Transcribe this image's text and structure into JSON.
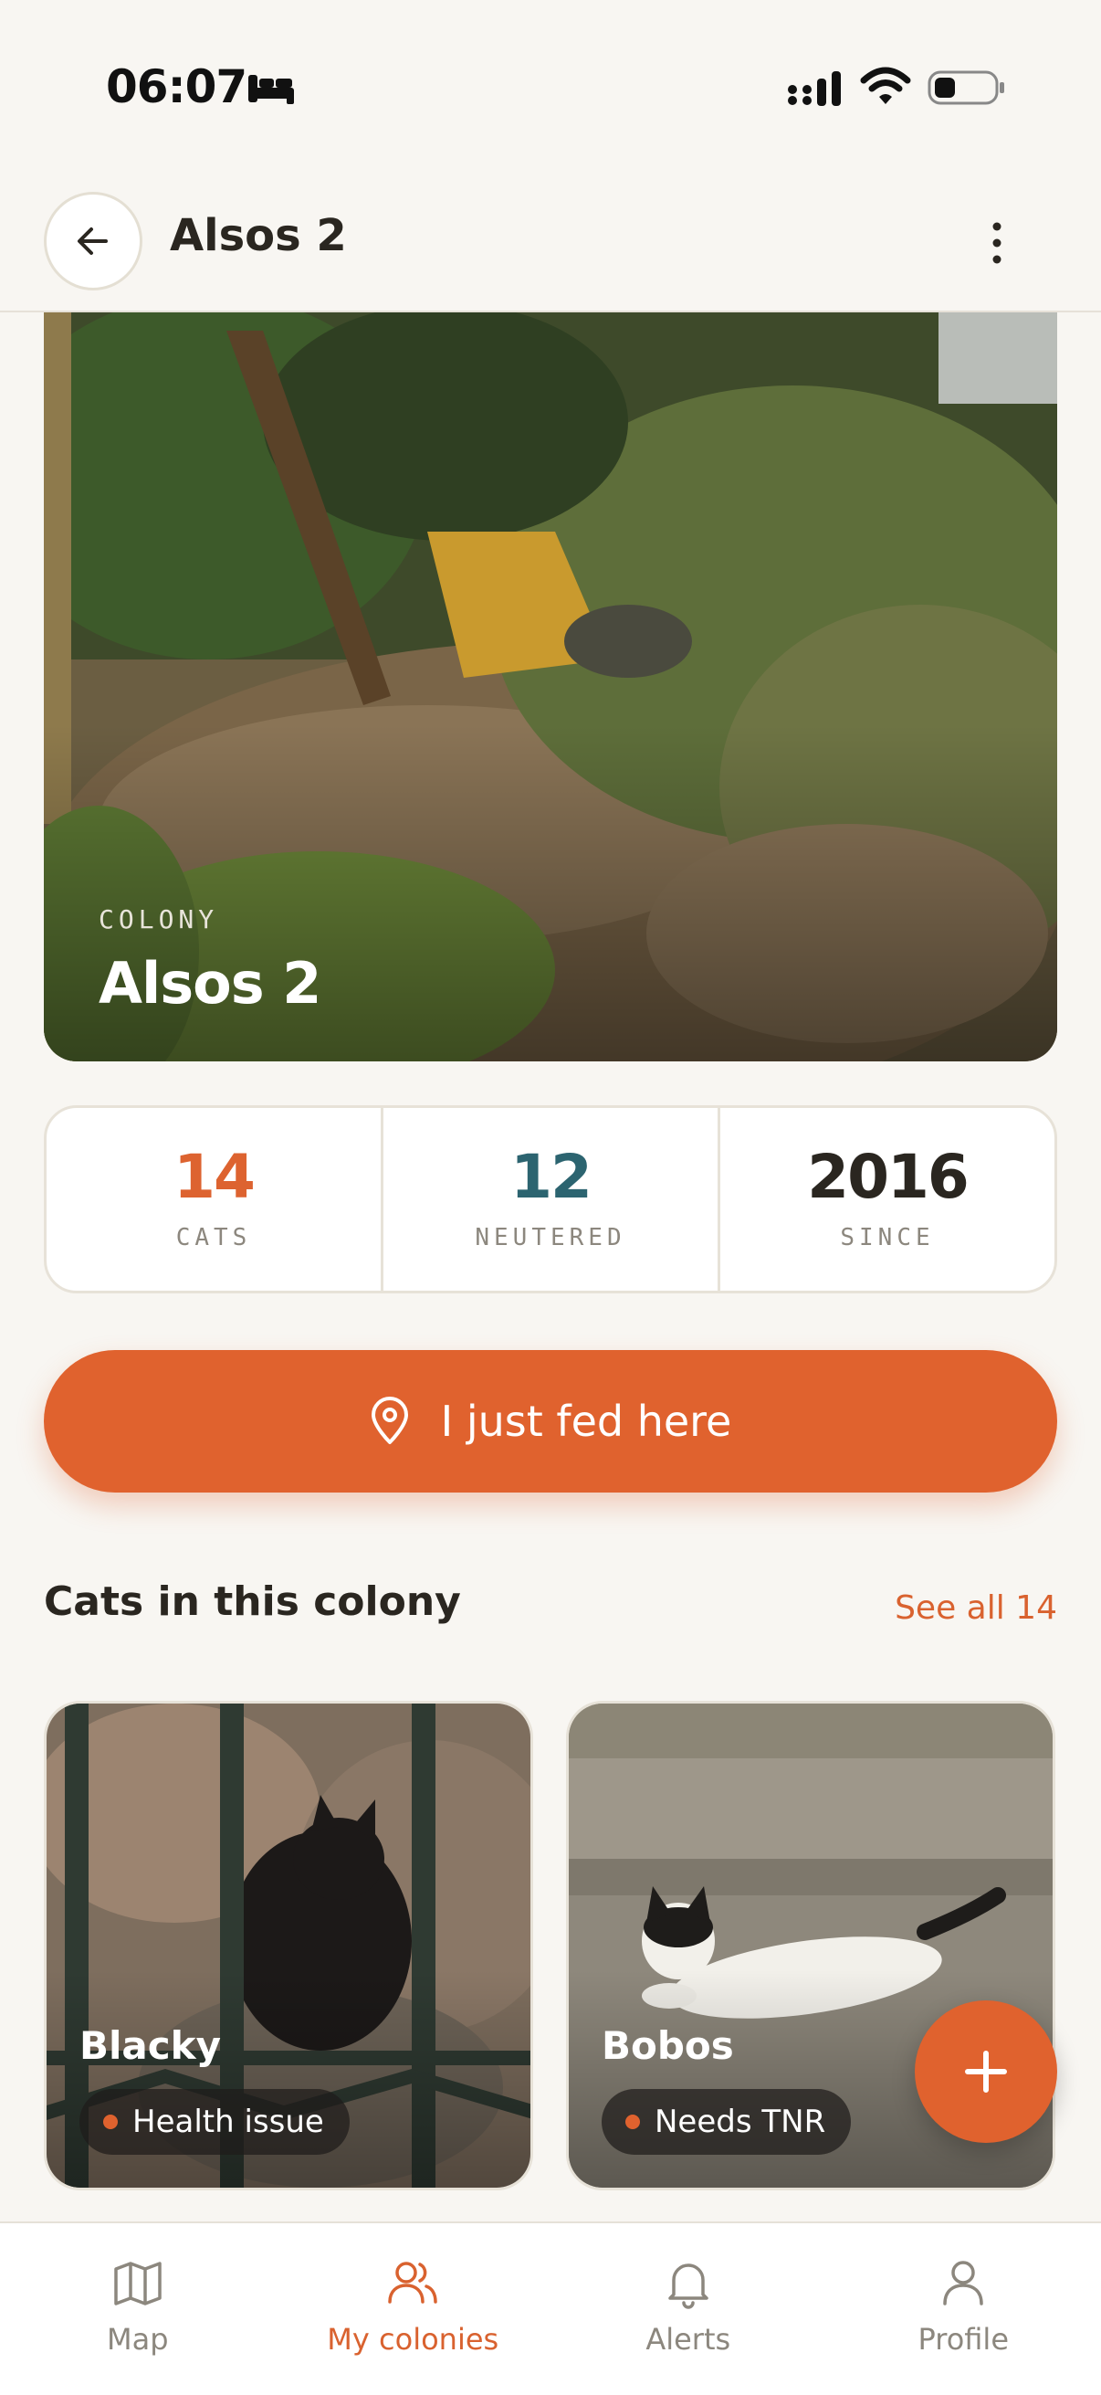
{
  "status_bar": {
    "time": "06:07"
  },
  "header": {
    "title": "Alsos 2"
  },
  "hero": {
    "kicker": "COLONY",
    "title": "Alsos 2"
  },
  "stats": [
    {
      "value": "14",
      "label": "CATS",
      "color": "#DD6330"
    },
    {
      "value": "12",
      "label": "NEUTERED",
      "color": "#2C6470"
    },
    {
      "value": "2016",
      "label": "SINCE",
      "color": "#2A2620"
    }
  ],
  "fed_button": {
    "label": "I just fed here"
  },
  "cats_section": {
    "title": "Cats in this colony",
    "see_all": "See all 14"
  },
  "cats": [
    {
      "name": "Blacky",
      "status": "Health issue"
    },
    {
      "name": "Bobos",
      "status": "Needs TNR"
    }
  ],
  "bottom_nav": [
    {
      "label": "Map",
      "icon": "map-icon",
      "active": false
    },
    {
      "label": "My colonies",
      "icon": "users-icon",
      "active": true
    },
    {
      "label": "Alerts",
      "icon": "bell-icon",
      "active": false
    },
    {
      "label": "Profile",
      "icon": "user-icon",
      "active": false
    }
  ],
  "colors": {
    "accent": "#E0622E",
    "teal": "#2C6470",
    "background": "#F8F6F2"
  }
}
